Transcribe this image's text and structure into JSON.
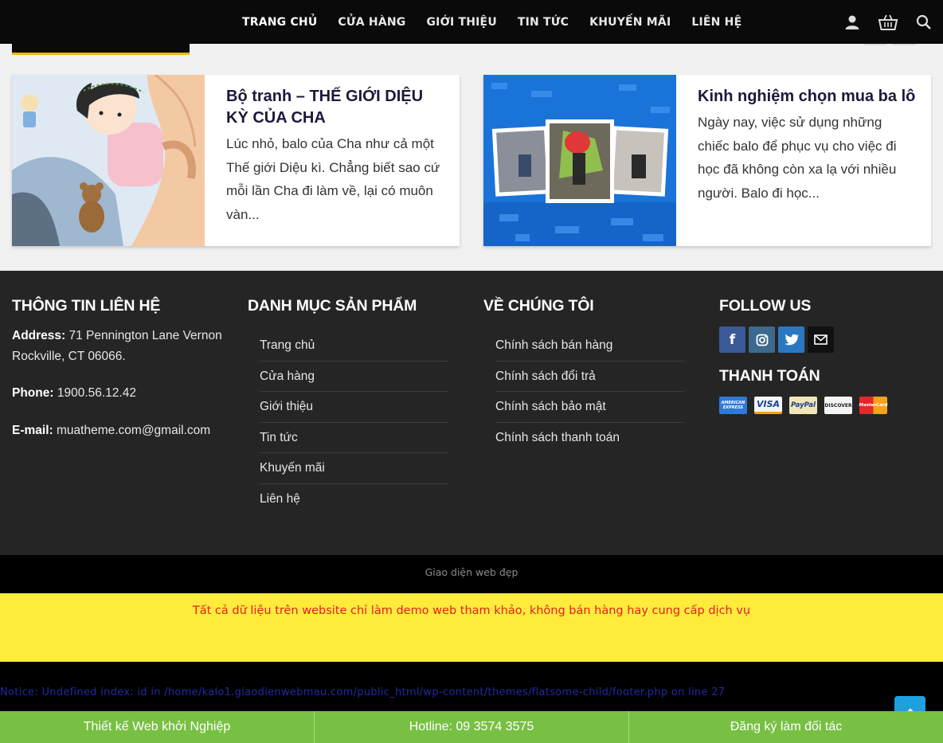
{
  "nav": {
    "items": [
      "TRANG CHỦ",
      "CỬA HÀNG",
      "GIỚI THIỆU",
      "TIN TỨC",
      "KHUYẾN MÃI",
      "LIÊN HỆ"
    ],
    "icons": [
      "user-icon",
      "basket-icon",
      "search-icon"
    ]
  },
  "posts": [
    {
      "title": "Bộ tranh – THẾ GIỚI DIỆU KỲ CỦA CHA",
      "excerpt": "Lúc nhỏ, balo của Cha như cả một Thế giới Diệu kì. Chẳng biết sao cứ mỗi lần Cha đi làm về, lại có muôn vàn..."
    },
    {
      "title": "Kinh nghiệm chọn mua ba lô",
      "excerpt": "Ngày nay, việc sử dụng những chiếc balo để phục vụ cho việc đi học đã không còn xa lạ với nhiều người. Balo đi học..."
    }
  ],
  "footer": {
    "contact": {
      "heading": "THÔNG TIN LIÊN HỆ",
      "address_label": "Address:",
      "address": "71 Pennington Lane Vernon Rockville, CT 06066.",
      "phone_label": "Phone:",
      "phone": "1900.56.12.42",
      "email_label": "E-mail:",
      "email": "muatheme.com@gmail.com"
    },
    "categories": {
      "heading": "DANH MỤC SẢN PHẨM",
      "items": [
        "Trang chủ",
        "Cửa hàng",
        "Giới thiệu",
        "Tin tức",
        "Khuyến mãi",
        "Liên hệ"
      ]
    },
    "about": {
      "heading": "VỀ CHÚNG TÔI",
      "items": [
        "Chính sách bán hàng",
        "Chính sách đổi trả",
        "Chính sách bảo mật",
        "Chính sách thanh toán"
      ]
    },
    "follow": {
      "heading": "FOLLOW US",
      "icons": [
        "facebook-icon",
        "instagram-icon",
        "twitter-icon",
        "email-icon"
      ],
      "colors": [
        "#3a5a98",
        "#3c6a8e",
        "#2b78c2",
        "#111111"
      ]
    },
    "payment": {
      "heading": "THANH TOÁN",
      "cards": [
        "AMERICAN EXPRESS",
        "VISA",
        "PayPal",
        "DISCOVER",
        "MasterCard"
      ]
    }
  },
  "copyright": "Giao diện web đẹp",
  "notice": "Tất cả dữ liệu trên website chỉ làm demo web tham khảo, không bán hàng hay cung cấp dịch vụ",
  "php_notice": "Notice: Undefined index: id in /home/kalo1.giaodienwebmau.com/public_html/wp-content/themes/flatsome-child/footer.php on line 27",
  "bottom_bar": [
    "Thiết kế Web khởi Nghiệp",
    "Hotline: 09 3574 3575",
    "Đăng ký làm đối tác"
  ]
}
